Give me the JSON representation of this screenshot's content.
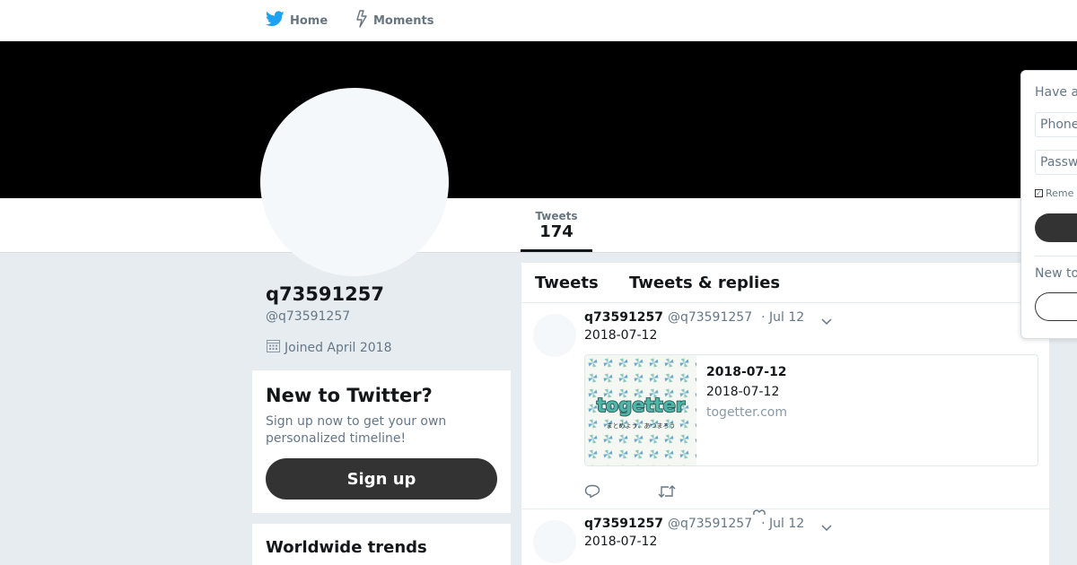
{
  "nav": {
    "home_label": "Home",
    "moments_label": "Moments"
  },
  "profile": {
    "name": "q73591257",
    "handle": "@q73591257",
    "joined": "Joined April 2018",
    "stats": {
      "tweets_label": "Tweets",
      "tweets_count": "174"
    }
  },
  "signup_card": {
    "title": "New to Twitter?",
    "text": "Sign up now to get your own personalized timeline!",
    "button_label": "Sign up"
  },
  "trends": {
    "title": "Worldwide trends"
  },
  "timeline": {
    "tabs": [
      {
        "label": "Tweets"
      },
      {
        "label": "Tweets & replies"
      }
    ],
    "tweets": [
      {
        "name": "q73591257",
        "handle": "@q73591257",
        "time": "· Jul 12",
        "text": "2018-07-12",
        "card": {
          "title": "2018-07-12",
          "description": "2018-07-12",
          "domain": "togetter.com",
          "image_logo_text": "togetter",
          "image_tagline": "まとめよう、あつまろう"
        }
      },
      {
        "name": "q73591257",
        "handle": "@q73591257",
        "time": "· Jul 12",
        "text": "2018-07-12"
      }
    ]
  },
  "login": {
    "title": "Have a",
    "phone_placeholder": "Phone",
    "password_placeholder": "Passw",
    "remember_label": "Reme",
    "new_to_label": "New to"
  },
  "colors": {
    "twitter_blue": "#1da1f2",
    "background": "#e6ecf0",
    "banner": "#000000",
    "button_dark": "#333333",
    "secondary_text": "#657786"
  }
}
